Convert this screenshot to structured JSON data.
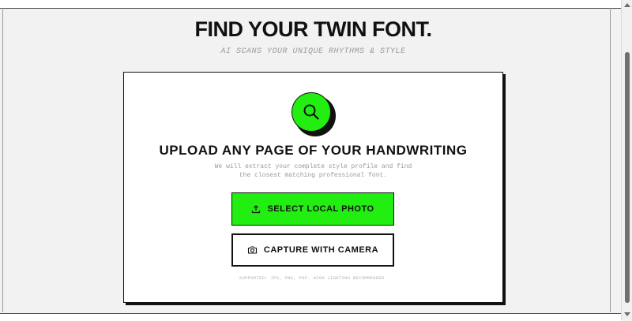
{
  "header": {
    "title": "FIND YOUR TWIN FONT.",
    "subtitle": "AI SCANS YOUR UNIQUE RHYTHMS & STYLE"
  },
  "upload_card": {
    "heading": "UPLOAD ANY PAGE OF YOUR HANDWRITING",
    "description_line_1": "We will extract your complete style profile and find",
    "description_line_2": "the closest matching professional font.",
    "select_button_label": "SELECT LOCAL PHOTO",
    "camera_button_label": "CAPTURE WITH CAMERA",
    "supported_note": "SUPPORTED: JPG, PNG, PDF. HIGH LIGHTING RECOMMENDED."
  },
  "icons": {
    "card_icon": "search-icon",
    "select_button_icon": "upload-icon",
    "camera_button_icon": "camera-icon"
  },
  "colors": {
    "accent": "#22ee11",
    "ink": "#111111",
    "muted_text": "#9a9a9a",
    "background": "#f2f2f2",
    "card": "#ffffff"
  }
}
